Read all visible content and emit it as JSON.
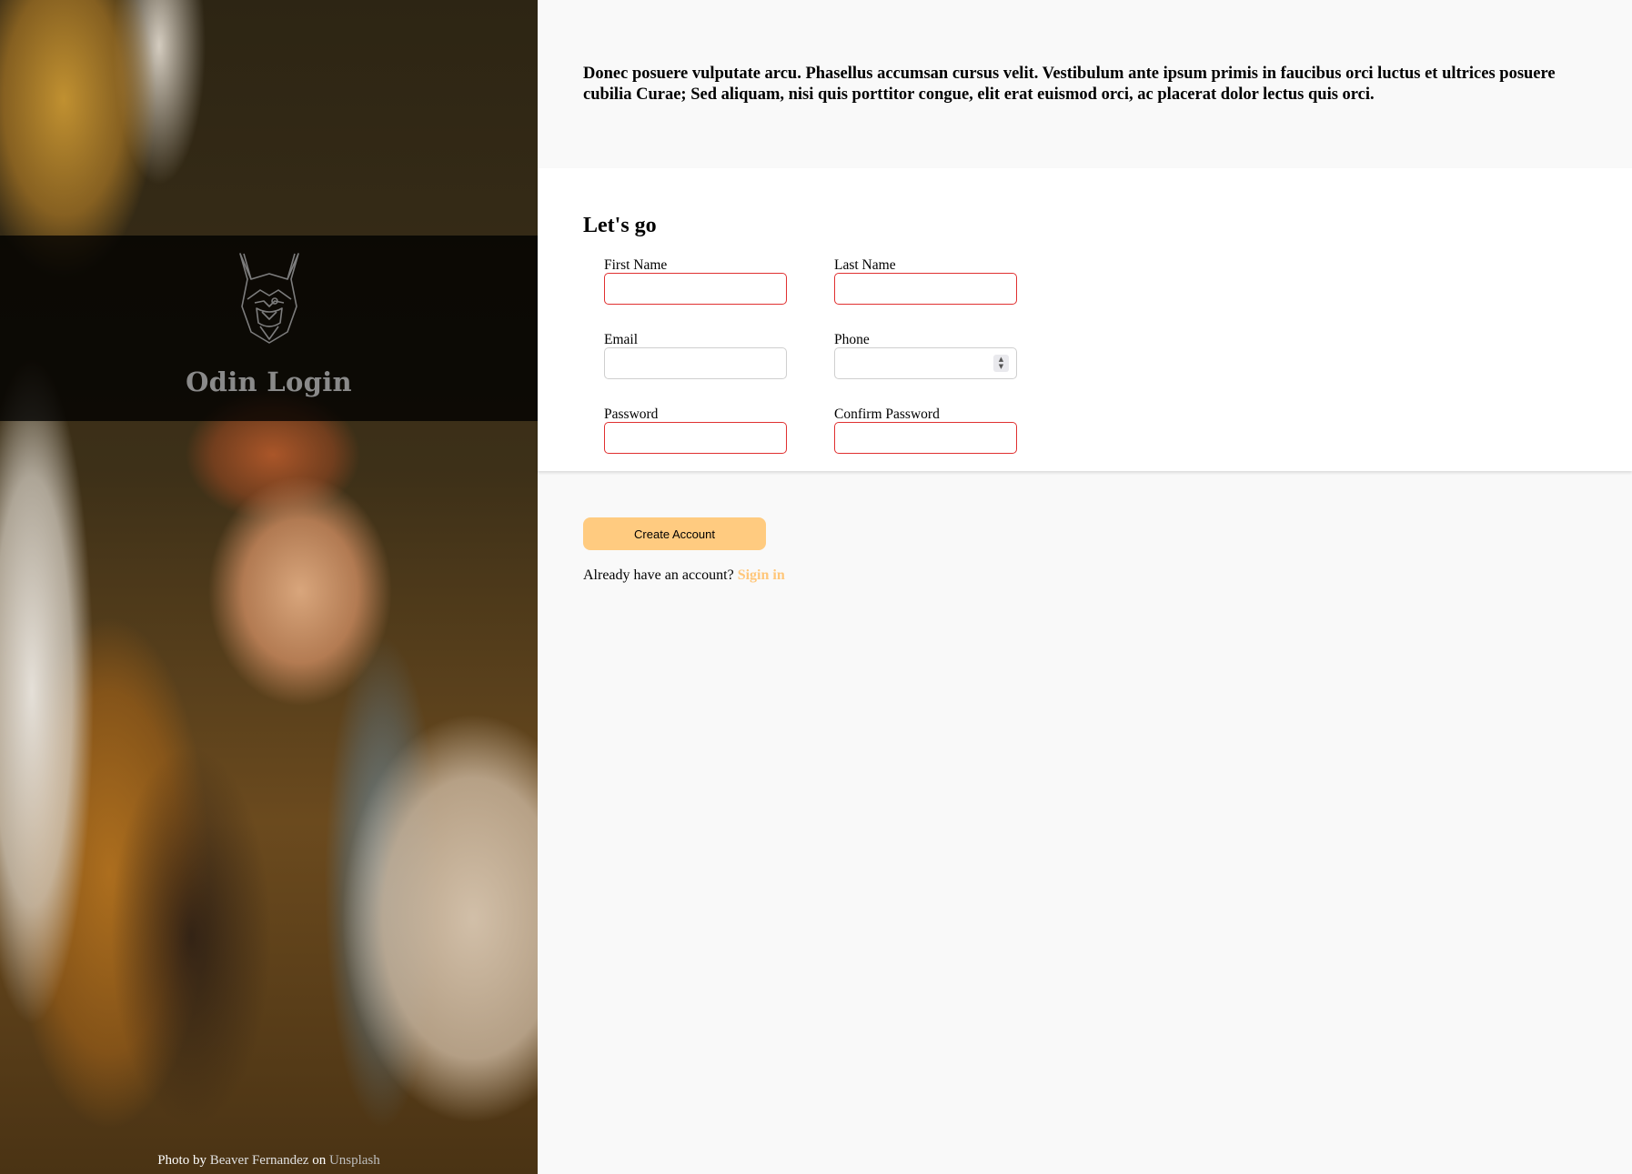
{
  "sidebar": {
    "brand_title": "Odin Login",
    "credit": {
      "prefix": "Photo by ",
      "photographer": "Beaver Fernandez",
      "middle": " on ",
      "source": "Unsplash"
    }
  },
  "intro": {
    "text": "Donec posuere vulputate arcu. Phasellus accumsan cursus velit. Vestibulum ante ipsum primis in faucibus orci luctus et ultrices posuere cubilia Curae; Sed aliquam, nisi quis porttitor congue, elit erat euismod orci, ac placerat dolor lectus quis orci."
  },
  "form": {
    "heading": "Let's go",
    "fields": {
      "first_name": {
        "label": "First Name",
        "value": ""
      },
      "last_name": {
        "label": "Last Name",
        "value": ""
      },
      "email": {
        "label": "Email",
        "value": ""
      },
      "phone": {
        "label": "Phone",
        "value": ""
      },
      "password": {
        "label": "Password",
        "value": ""
      },
      "confirm_password": {
        "label": "Confirm Password",
        "value": ""
      }
    }
  },
  "actions": {
    "create_label": "Create Account",
    "signin_prompt": "Already have an account? ",
    "signin_link": "Sigin in"
  },
  "colors": {
    "accent": "#ffcb80",
    "link": "#ffc77a",
    "invalid_border": "#e03030",
    "background": "#f9f9f9"
  },
  "icons": {
    "logo": "odin-wolf-logo-icon",
    "phone_spinner": "spinner-arrows-icon"
  }
}
